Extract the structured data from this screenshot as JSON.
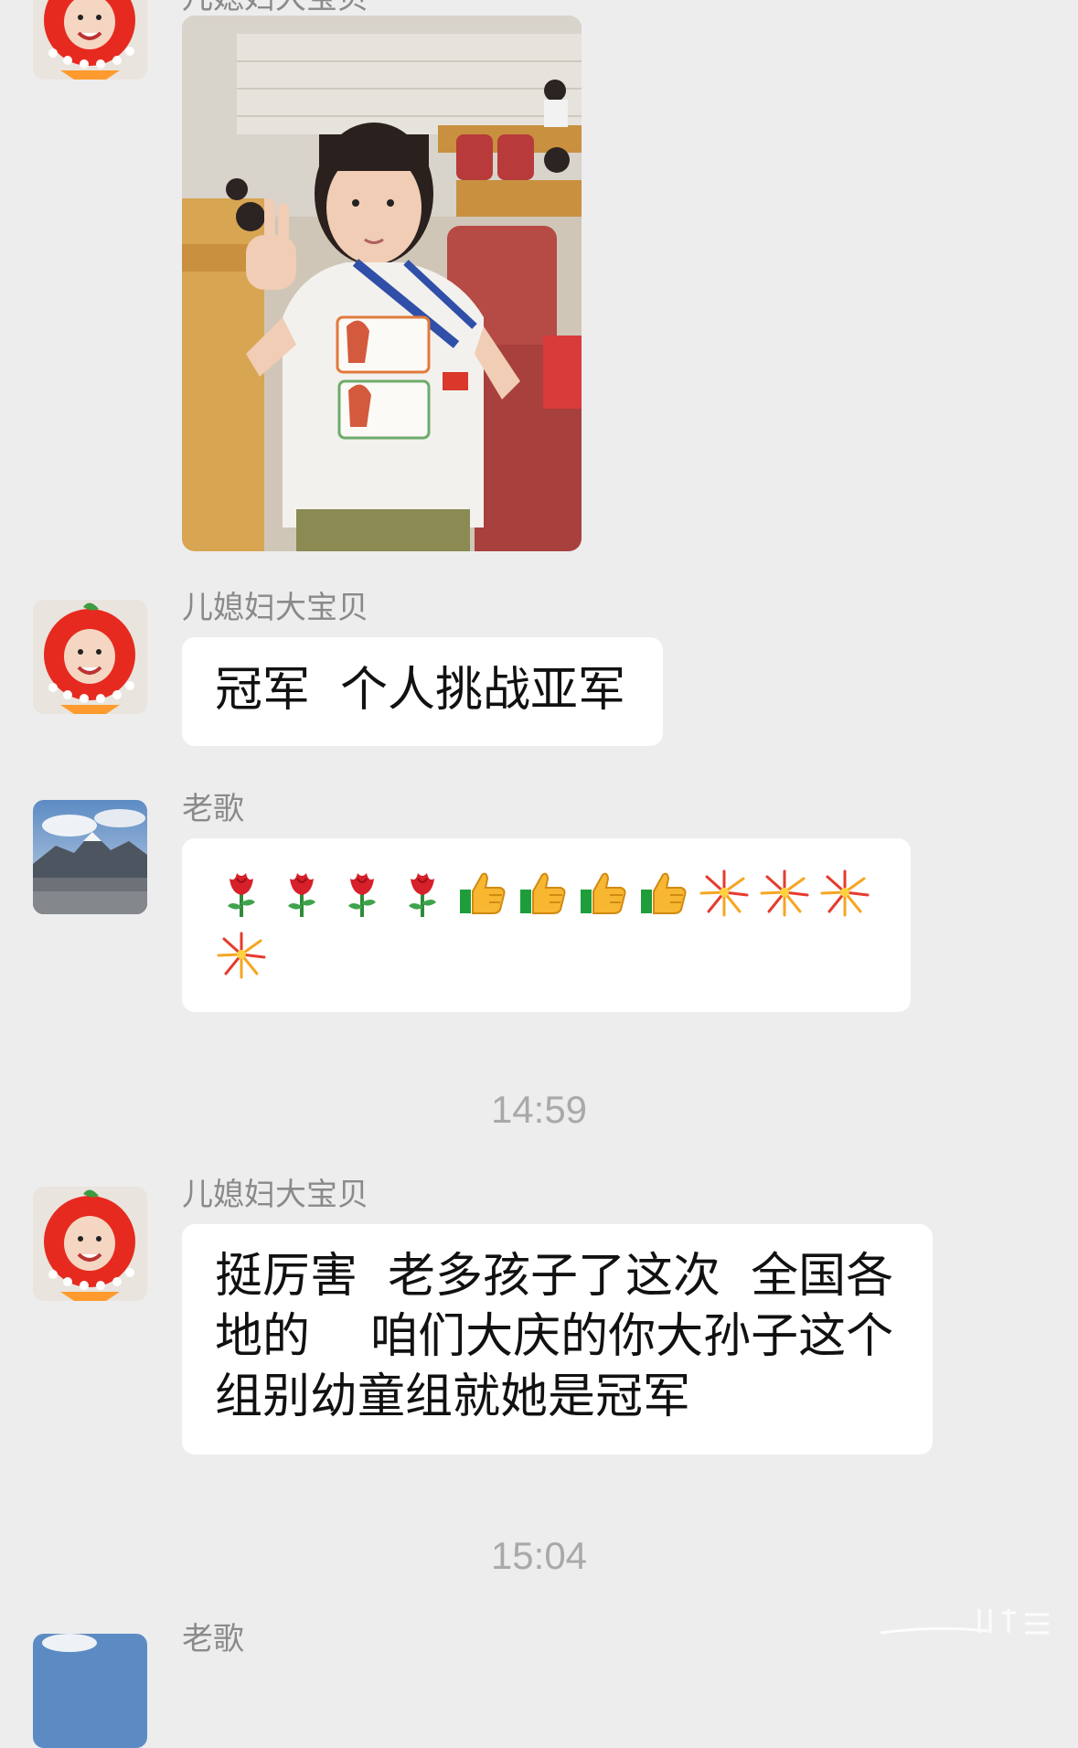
{
  "messages": [
    {
      "type": "image",
      "sender": "儿媳妇大宝贝",
      "image_alt": "photo-of-child-with-medal"
    },
    {
      "type": "text",
      "sender": "儿媳妇大宝贝",
      "text": "冠军  个人挑战亚军"
    },
    {
      "type": "emoji",
      "sender": "老歌",
      "emojis": [
        "rose",
        "rose",
        "rose",
        "rose",
        "thumbs-up",
        "thumbs-up",
        "thumbs-up",
        "thumbs-up",
        "fireworks",
        "fireworks",
        "fireworks",
        "fireworks"
      ]
    },
    {
      "type": "timestamp",
      "text": "14:59"
    },
    {
      "type": "text",
      "sender": "儿媳妇大宝贝",
      "text": "挺厉害  老多孩子了这次  全国各地的    咱们大庆的你大孙子这个组别幼童组就她是冠军"
    },
    {
      "type": "timestamp",
      "text": "15:04"
    },
    {
      "type": "partial",
      "sender": "老歌"
    }
  ],
  "colors": {
    "background": "#ededed",
    "bubble": "#ffffff",
    "sender_text": "#8a8a8a",
    "timestamp_text": "#a9a9a9"
  }
}
